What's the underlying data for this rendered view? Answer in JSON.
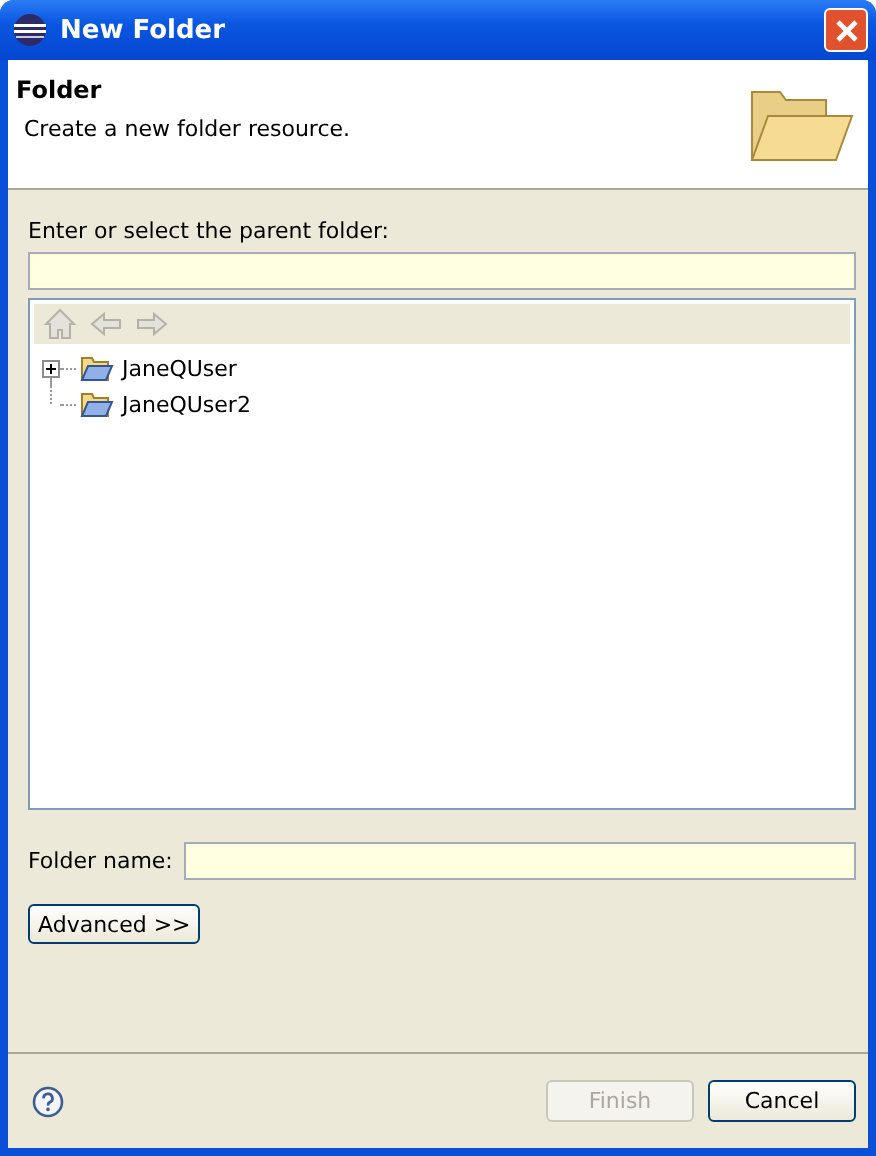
{
  "window": {
    "title": "New Folder"
  },
  "header": {
    "title": "Folder",
    "description": "Create a new folder resource."
  },
  "parent_folder": {
    "label": "Enter or select the parent folder:"
  },
  "tree_toolbar": [
    {
      "kind": "home",
      "disabled": true
    },
    {
      "kind": "back",
      "disabled": true
    },
    {
      "kind": "forward",
      "disabled": true
    }
  ],
  "tree": [
    {
      "label": "JaneQUser",
      "expanded": false
    },
    {
      "label": "JaneQUser2"
    }
  ],
  "folder_name": {
    "label": "Folder name:"
  },
  "advanced_button": "Advanced >>",
  "buttons": [
    {
      "label": "Finish",
      "disabled": true
    },
    {
      "label": "Cancel",
      "disabled": false
    }
  ]
}
